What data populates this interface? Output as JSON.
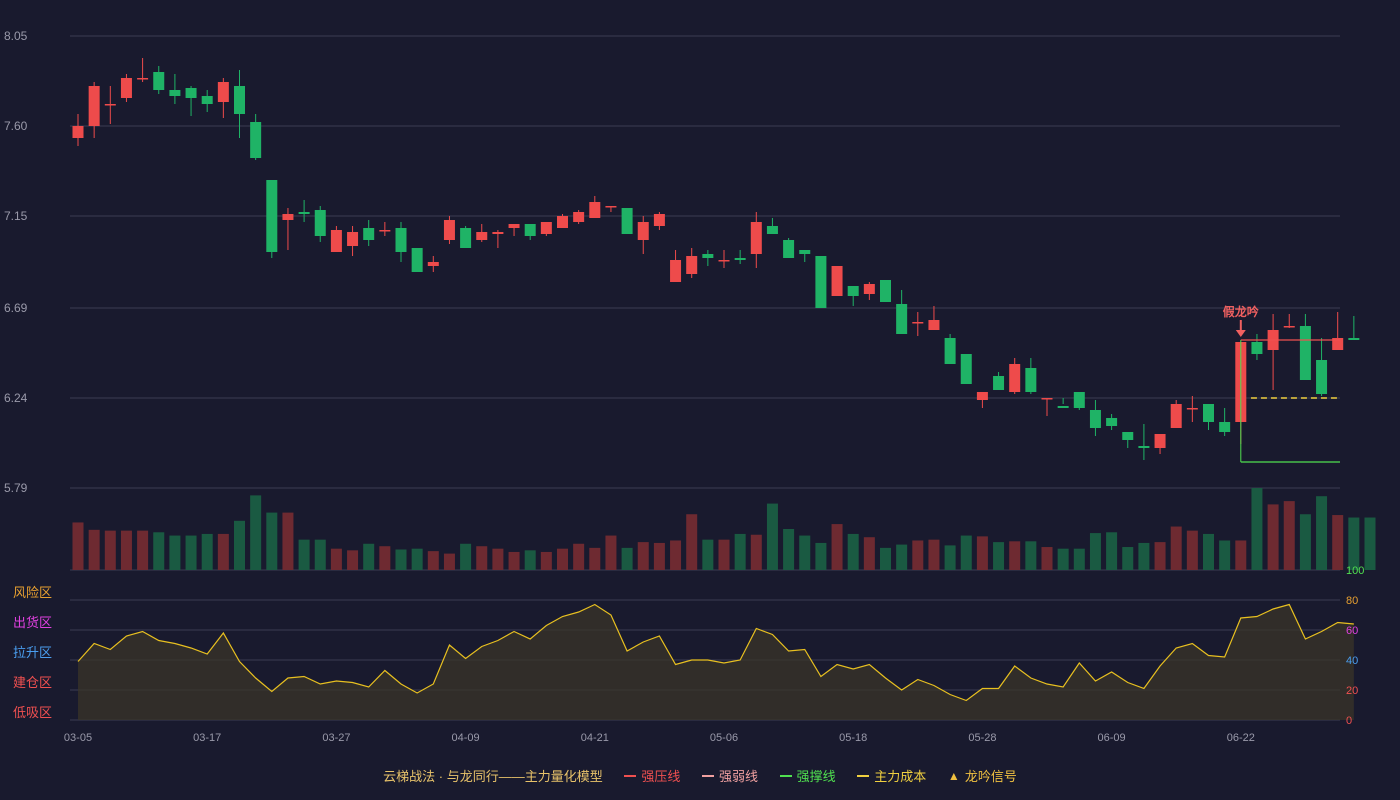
{
  "chart_data": {
    "type": "candlestick",
    "title": "",
    "price_axis": {
      "ticks": [
        "8.05",
        "7.60",
        "7.15",
        "6.69",
        "6.24",
        "5.79"
      ],
      "range": [
        5.79,
        8.05
      ]
    },
    "x_labels": [
      {
        "index": 0,
        "label": "03-05"
      },
      {
        "index": 8,
        "label": "03-17"
      },
      {
        "index": 16,
        "label": "03-27"
      },
      {
        "index": 24,
        "label": "04-09"
      },
      {
        "index": 32,
        "label": "04-21"
      },
      {
        "index": 40,
        "label": "05-06"
      },
      {
        "index": 48,
        "label": "05-18"
      },
      {
        "index": 56,
        "label": "05-28"
      },
      {
        "index": 64,
        "label": "06-09"
      },
      {
        "index": 72,
        "label": "06-22"
      }
    ],
    "ohlc": [
      [
        7.54,
        7.6,
        7.5,
        7.66
      ],
      [
        7.6,
        7.8,
        7.54,
        7.82
      ],
      [
        7.71,
        7.71,
        7.61,
        7.8
      ],
      [
        7.74,
        7.84,
        7.72,
        7.86
      ],
      [
        7.84,
        7.84,
        7.82,
        7.94
      ],
      [
        7.87,
        7.78,
        7.76,
        7.9
      ],
      [
        7.78,
        7.75,
        7.71,
        7.86
      ],
      [
        7.79,
        7.74,
        7.65,
        7.8
      ],
      [
        7.75,
        7.71,
        7.67,
        7.78
      ],
      [
        7.72,
        7.82,
        7.64,
        7.84
      ],
      [
        7.8,
        7.66,
        7.54,
        7.88
      ],
      [
        7.62,
        7.44,
        7.43,
        7.66
      ],
      [
        7.33,
        6.97,
        6.94,
        7.33
      ],
      [
        7.13,
        7.16,
        6.98,
        7.19
      ],
      [
        7.17,
        7.16,
        7.12,
        7.23
      ],
      [
        7.18,
        7.05,
        7.02,
        7.2
      ],
      [
        6.97,
        7.08,
        6.97,
        7.1
      ],
      [
        7.0,
        7.07,
        6.95,
        7.1
      ],
      [
        7.09,
        7.03,
        7.0,
        7.13
      ],
      [
        7.08,
        7.08,
        7.05,
        7.12
      ],
      [
        7.09,
        6.97,
        6.92,
        7.12
      ],
      [
        6.99,
        6.87,
        6.87,
        6.99
      ],
      [
        6.9,
        6.92,
        6.87,
        6.95
      ],
      [
        7.03,
        7.13,
        7.01,
        7.15
      ],
      [
        7.09,
        6.99,
        6.99,
        7.1
      ],
      [
        7.03,
        7.07,
        7.02,
        7.11
      ],
      [
        7.06,
        7.07,
        6.99,
        7.08
      ],
      [
        7.09,
        7.11,
        7.05,
        7.11
      ],
      [
        7.11,
        7.05,
        7.03,
        7.11
      ],
      [
        7.06,
        7.12,
        7.05,
        7.12
      ],
      [
        7.09,
        7.15,
        7.09,
        7.16
      ],
      [
        7.12,
        7.17,
        7.11,
        7.18
      ],
      [
        7.14,
        7.22,
        7.14,
        7.25
      ],
      [
        7.2,
        7.2,
        7.17,
        7.2
      ],
      [
        7.19,
        7.06,
        7.06,
        7.19
      ],
      [
        7.03,
        7.12,
        6.96,
        7.15
      ],
      [
        7.1,
        7.16,
        7.08,
        7.17
      ],
      [
        6.82,
        6.93,
        6.82,
        6.98
      ],
      [
        6.86,
        6.95,
        6.84,
        6.99
      ],
      [
        6.96,
        6.94,
        6.9,
        6.98
      ],
      [
        6.93,
        6.93,
        6.89,
        6.98
      ],
      [
        6.94,
        6.93,
        6.91,
        6.98
      ],
      [
        6.96,
        7.12,
        6.89,
        7.17
      ],
      [
        7.1,
        7.06,
        7.06,
        7.14
      ],
      [
        7.03,
        6.94,
        6.94,
        7.04
      ],
      [
        6.98,
        6.96,
        6.92,
        6.98
      ],
      [
        6.95,
        6.69,
        6.69,
        6.95
      ],
      [
        6.75,
        6.9,
        6.75,
        6.86
      ],
      [
        6.8,
        6.75,
        6.7,
        6.8
      ],
      [
        6.76,
        6.81,
        6.73,
        6.82
      ],
      [
        6.83,
        6.72,
        6.72,
        6.83
      ],
      [
        6.71,
        6.56,
        6.56,
        6.78
      ],
      [
        6.62,
        6.62,
        6.55,
        6.67
      ],
      [
        6.58,
        6.63,
        6.58,
        6.7
      ],
      [
        6.54,
        6.41,
        6.41,
        6.56
      ],
      [
        6.46,
        6.31,
        6.31,
        6.46
      ],
      [
        6.23,
        6.27,
        6.19,
        6.27
      ],
      [
        6.35,
        6.28,
        6.29,
        6.37
      ],
      [
        6.27,
        6.41,
        6.26,
        6.44
      ],
      [
        6.39,
        6.27,
        6.26,
        6.44
      ],
      [
        6.24,
        6.24,
        6.15,
        6.24
      ],
      [
        6.2,
        6.19,
        6.21,
        6.24
      ],
      [
        6.27,
        6.19,
        6.18,
        6.27
      ],
      [
        6.18,
        6.09,
        6.05,
        6.23
      ],
      [
        6.14,
        6.1,
        6.08,
        6.16
      ],
      [
        6.07,
        6.03,
        5.99,
        6.07
      ],
      [
        6.0,
        5.99,
        5.93,
        6.11
      ],
      [
        5.99,
        6.06,
        5.96,
        6.06
      ],
      [
        6.09,
        6.21,
        6.09,
        6.23
      ],
      [
        6.19,
        6.19,
        6.12,
        6.25
      ],
      [
        6.21,
        6.12,
        6.08,
        6.21
      ],
      [
        6.12,
        6.07,
        6.05,
        6.19
      ],
      [
        6.12,
        6.52,
        6.01,
        6.52
      ],
      [
        6.52,
        6.46,
        6.43,
        6.56
      ],
      [
        6.48,
        6.58,
        6.28,
        6.66
      ],
      [
        6.6,
        6.6,
        6.59,
        6.66
      ],
      [
        6.6,
        6.33,
        6.33,
        6.66
      ],
      [
        6.43,
        6.26,
        6.25,
        6.54
      ],
      [
        6.48,
        6.54,
        6.48,
        6.67
      ],
      [
        6.54,
        6.53,
        6.53,
        6.65
      ]
    ],
    "volume": {
      "max": 100,
      "values": [
        58,
        49,
        48,
        48,
        48,
        46,
        42,
        42,
        44,
        44,
        60,
        91,
        70,
        70,
        37,
        37,
        26,
        24,
        32,
        29,
        25,
        26,
        23,
        20,
        32,
        29,
        26,
        22,
        24,
        22,
        26,
        32,
        27,
        42,
        27,
        34,
        33,
        36,
        68,
        37,
        37,
        44,
        43,
        81,
        50,
        42,
        33,
        56,
        44,
        40,
        27,
        31,
        36,
        37,
        30,
        42,
        41,
        34,
        35,
        35,
        28,
        26,
        26,
        45,
        46,
        28,
        33,
        34,
        53,
        48,
        44,
        36,
        36,
        100,
        80,
        84,
        68,
        90,
        67,
        64,
        64
      ]
    },
    "oscillator": {
      "ticks": [
        "100",
        "80",
        "60",
        "40",
        "20",
        "0"
      ],
      "range": [
        0,
        100
      ],
      "zones": [
        {
          "label": "风险区",
          "level": 80,
          "color": "#e8a030"
        },
        {
          "label": "出货区",
          "level": 60,
          "color": "#e040e0"
        },
        {
          "label": "拉升区",
          "level": 40,
          "color": "#4a9ef0"
        },
        {
          "label": "建仓区",
          "level": 20,
          "color": "#f05050"
        },
        {
          "label": "低吸区",
          "level": 0,
          "color": "#f05050"
        }
      ],
      "values": [
        39,
        51,
        47,
        56,
        59,
        53,
        51,
        48,
        44,
        58,
        39,
        28,
        19,
        28,
        29,
        24,
        26,
        25,
        22,
        33,
        24,
        18,
        24,
        50,
        41,
        49,
        53,
        59,
        54,
        63,
        69,
        72,
        77,
        70,
        46,
        52,
        56,
        37,
        40,
        40,
        38,
        40,
        61,
        57,
        46,
        47,
        29,
        37,
        34,
        37,
        28,
        20,
        27,
        23,
        17,
        13,
        21,
        21,
        36,
        28,
        24,
        22,
        38,
        26,
        32,
        25,
        21,
        36,
        48,
        51,
        43,
        42,
        68,
        69,
        74,
        77,
        54,
        59,
        65,
        64
      ]
    },
    "support_line": 5.92,
    "pressure_line": 6.53,
    "cost_line": 6.24,
    "signal_index": 72,
    "annotation": "假龙吟",
    "colors": {
      "up": "#ee4b4b",
      "down": "#1fb366",
      "vol_up": "#6e2a31",
      "vol_down": "#1a5a42",
      "pressure": "#f05050",
      "weak": "#f0a0a0",
      "support": "#50e050",
      "cost": "#f0d040",
      "osc_line": "#e8c020",
      "grid": "#3a3c52",
      "axis_text": "#9a9aaa"
    }
  },
  "legend": {
    "title": "云梯战法 · 与龙同行——主力量化模型",
    "items": [
      {
        "label": "强压线",
        "color": "#f05050",
        "style": "solid"
      },
      {
        "label": "强弱线",
        "color": "#f0a0a0",
        "style": "dashed"
      },
      {
        "label": "强撑线",
        "color": "#50e050",
        "style": "solid"
      },
      {
        "label": "主力成本",
        "color": "#f0d040",
        "style": "dashed"
      },
      {
        "label": "龙吟信号",
        "color": "#f0c040",
        "style": "triangle",
        "icon": "triangle-icon"
      }
    ]
  }
}
